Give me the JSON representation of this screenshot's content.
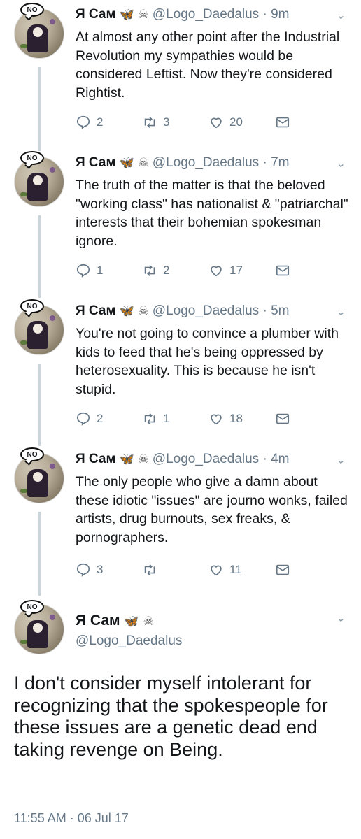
{
  "tweets": [
    {
      "no_label": "NO",
      "name": "Я Сам",
      "handle": "@Logo_Daedalus",
      "dot": "·",
      "time": "9m",
      "text": "At almost any other point after the Industrial Revolution my sympathies would be considered Leftist. Now they're considered Rightist.",
      "replies": "2",
      "retweets": "3",
      "likes": "20"
    },
    {
      "no_label": "NO",
      "name": "Я Сам",
      "handle": "@Logo_Daedalus",
      "dot": "·",
      "time": "7m",
      "text": "The truth of the matter is that the beloved \"working class\" has nationalist & \"patriarchal\" interests that their bohemian spokesman ignore.",
      "replies": "1",
      "retweets": "2",
      "likes": "17"
    },
    {
      "no_label": "NO",
      "name": "Я Сам",
      "handle": "@Logo_Daedalus",
      "dot": "·",
      "time": "5m",
      "text": "You're not going to convince a plumber with kids to feed that he's being oppressed by heterosexuality. This is because he isn't stupid.",
      "replies": "2",
      "retweets": "1",
      "likes": "18"
    },
    {
      "no_label": "NO",
      "name": "Я Сам",
      "handle": "@Logo_Daedalus",
      "dot": "·",
      "time": "4m",
      "text": "The only people who give a damn about these idiotic \"issues\" are journo wonks, failed artists, drug burnouts, sex freaks, & pornographers.",
      "replies": "3",
      "retweets": "",
      "likes": "11"
    }
  ],
  "focus": {
    "no_label": "NO",
    "name": "Я Сам",
    "handle": "@Logo_Daedalus",
    "text": "I don't consider myself intolerant for recognizing that the spokespeople for these issues are a genetic dead end taking revenge on Being.",
    "timestamp": "11:55 AM · 06 Jul 17"
  },
  "icons": {
    "butterfly": "🦋",
    "skull": "☠",
    "caret": "⌄"
  },
  "colors": {
    "text": "#14171a",
    "secondary": "#657786",
    "thread_line": "#cbd5dc",
    "butterfly": "#e8890c"
  }
}
